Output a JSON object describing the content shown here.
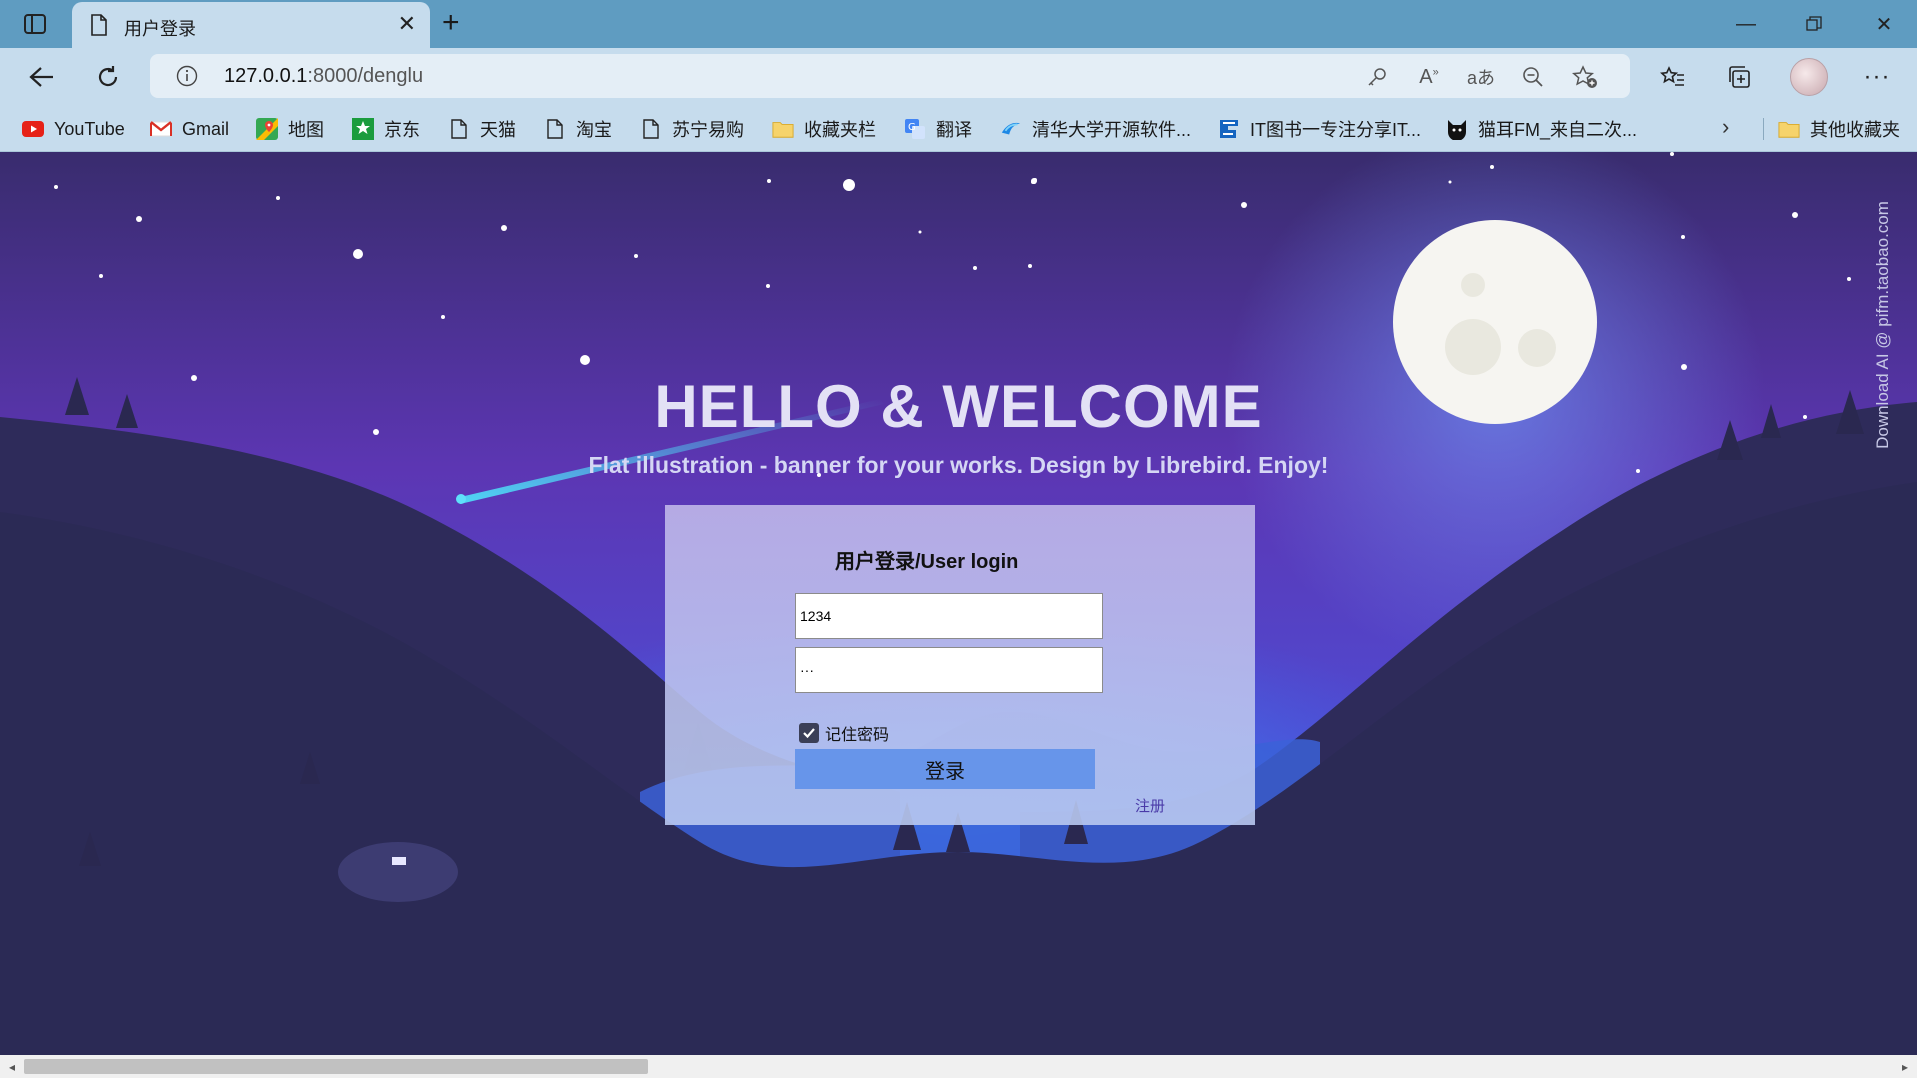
{
  "browser": {
    "tab": {
      "title": "用户登录"
    },
    "address": {
      "url_host": "127.0.0.1",
      "url_rest": ":8000/denglu"
    },
    "bookmarks": [
      {
        "label": "YouTube",
        "icon": "youtube-icon"
      },
      {
        "label": "Gmail",
        "icon": "gmail-icon"
      },
      {
        "label": "地图",
        "icon": "maps-icon"
      },
      {
        "label": "京东",
        "icon": "jd-icon"
      },
      {
        "label": "天猫",
        "icon": "page-icon"
      },
      {
        "label": "淘宝",
        "icon": "page-icon"
      },
      {
        "label": "苏宁易购",
        "icon": "page-icon"
      },
      {
        "label": "收藏夹栏",
        "icon": "folder-icon"
      },
      {
        "label": "翻译",
        "icon": "translate-icon"
      },
      {
        "label": "清华大学开源软件...",
        "icon": "tsinghua-icon"
      },
      {
        "label": "IT图书一专注分享IT...",
        "icon": "itbook-icon"
      },
      {
        "label": "猫耳FM_来自二次...",
        "icon": "cat-icon"
      }
    ],
    "other_bookmarks": "其他收藏夹",
    "colors": {
      "tabbar": "#5f9cc1",
      "toolbar": "#c6dced"
    }
  },
  "page": {
    "hero_title": "HELLO & WELCOME",
    "hero_subtitle": "Flat illustration - banner for your works. Design by Librebird. Enjoy!",
    "watermark": "Download AI @ pifm.taobao.com",
    "login": {
      "title": "用户登录/User login",
      "username_value": "1234",
      "password_value": "···",
      "remember_label": "记住密码",
      "remember_checked": true,
      "submit_label": "登录",
      "register_label": "注册"
    },
    "colors": {
      "sky_top": "#3a2f78",
      "sky_mid": "#6a3fc0",
      "mountain": "#2e2d58",
      "button": "#6795ea"
    }
  }
}
